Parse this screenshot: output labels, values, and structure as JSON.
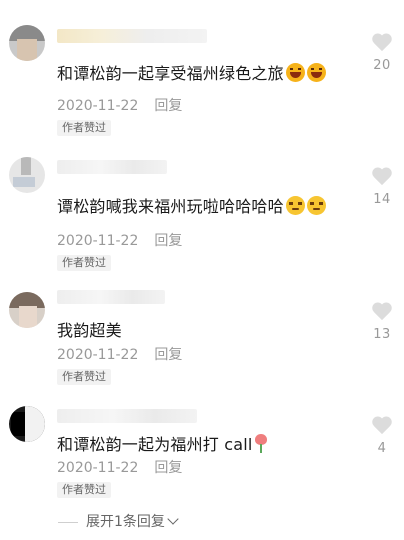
{
  "comments": [
    {
      "text": "和谭松韵一起享受福州绿色之旅",
      "emoji": [
        "laugh-emoji",
        "laugh-emoji"
      ],
      "date": "2020-11-22",
      "reply_label": "回复",
      "badge": "作者赞过",
      "likes": "20"
    },
    {
      "text": "谭松韵喊我来福州玩啦哈哈哈哈",
      "emoji": [
        "smirk-emoji",
        "smirk-emoji"
      ],
      "date": "2020-11-22",
      "reply_label": "回复",
      "badge": "作者赞过",
      "likes": "14"
    },
    {
      "text": "我韵超美",
      "emoji": [],
      "date": "2020-11-22",
      "reply_label": "回复",
      "badge": "作者赞过",
      "likes": "13"
    },
    {
      "text": "和谭松韵一起为福州打 call",
      "emoji": [
        "rose-emoji"
      ],
      "date": "2020-11-22",
      "reply_label": "回复",
      "badge": "作者赞过",
      "likes": "4"
    }
  ],
  "footer": {
    "expand_label": "展开1条回复"
  },
  "colors": {
    "like_heart": "#dcdcdc",
    "meta_text": "#999999",
    "badge_bg": "#f2f2f2"
  }
}
